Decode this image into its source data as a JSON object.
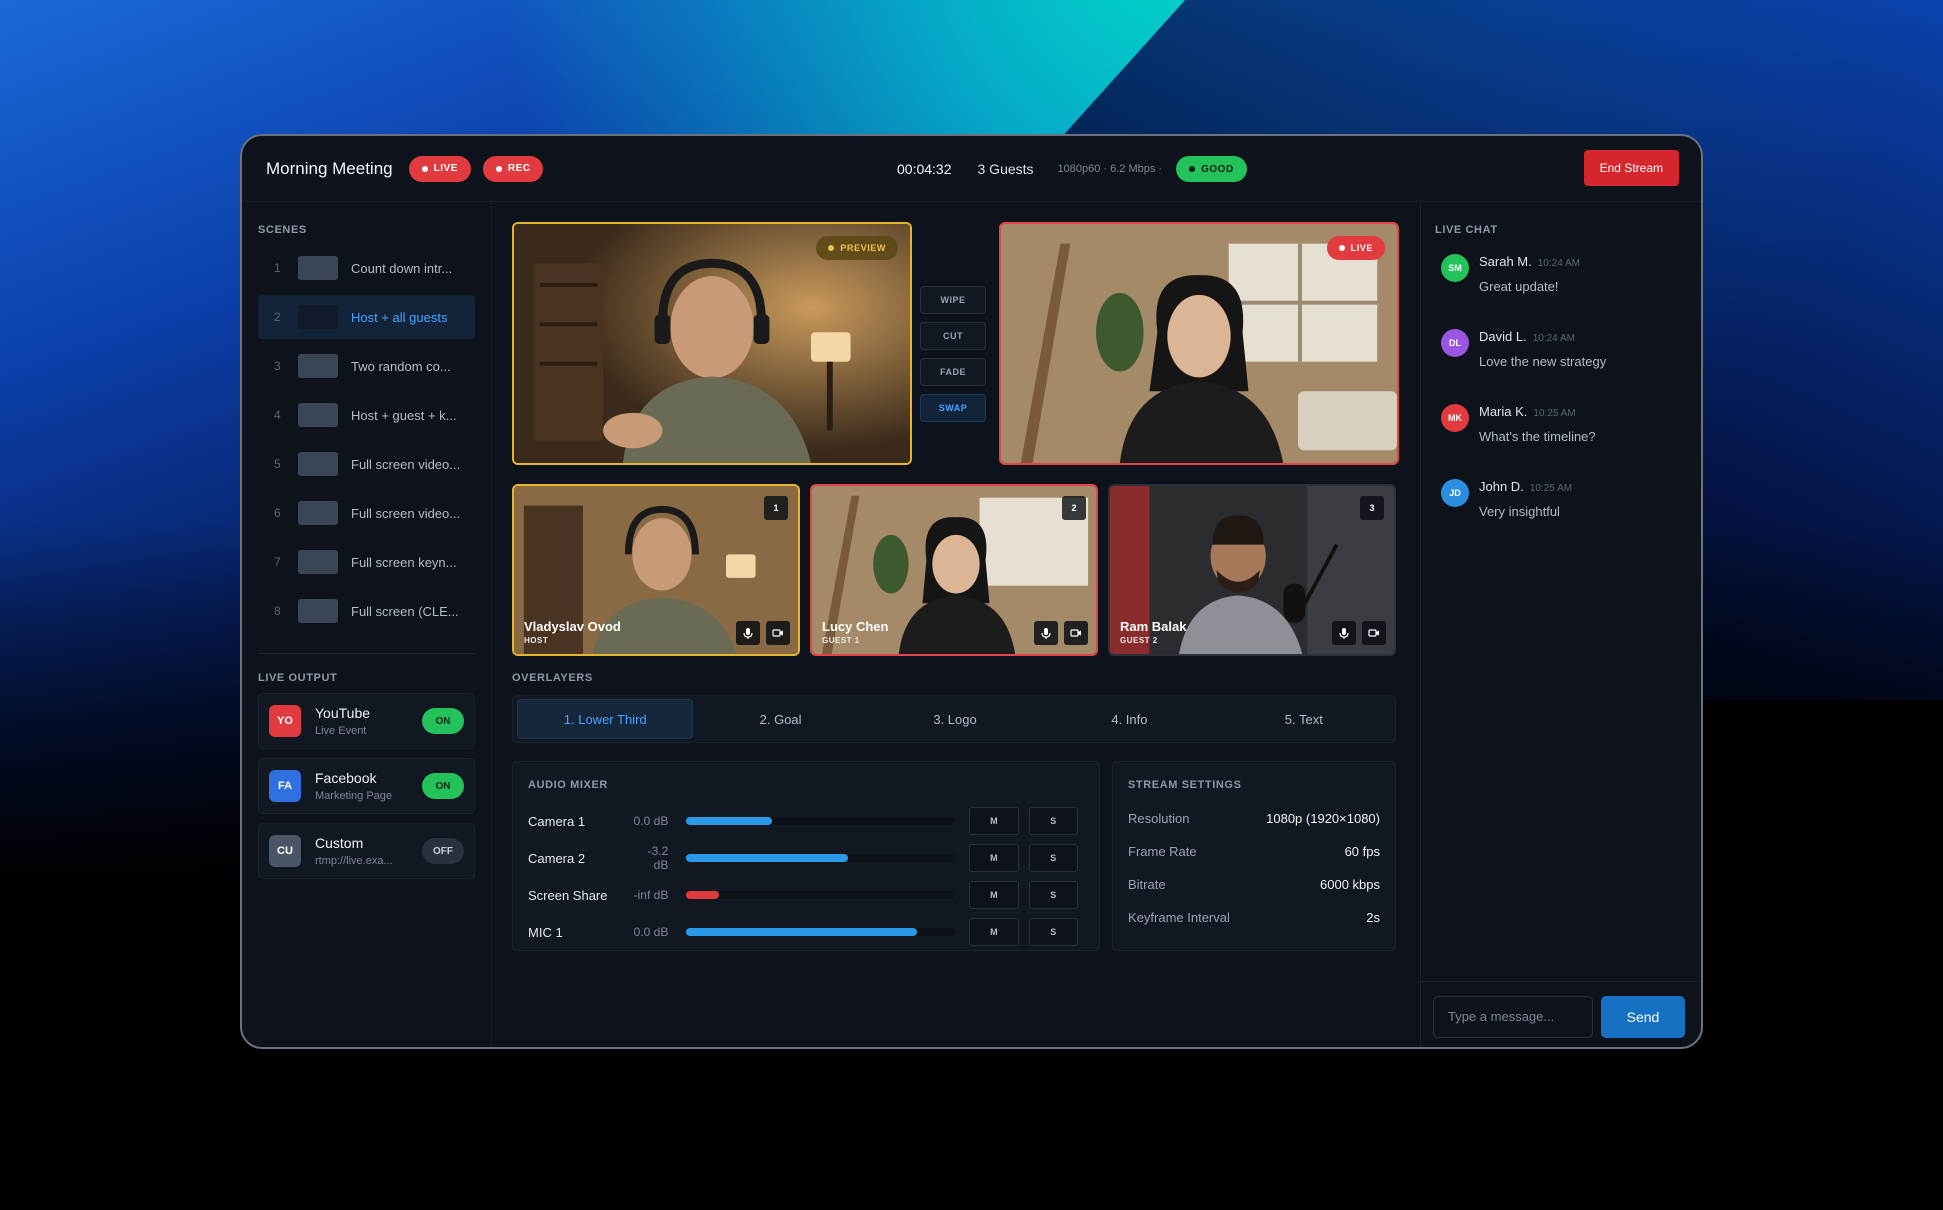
{
  "header": {
    "title": "Morning Meeting",
    "live_label": "LIVE",
    "rec_label": "REC",
    "timer": "00:04:32",
    "guests": "3 Guests",
    "stats": "1080p60 · 6.2 Mbps ·",
    "quality_label": "GOOD",
    "end_button": "End Stream"
  },
  "sidebar": {
    "scenes_title": "SCENES",
    "scenes": [
      {
        "num": "1",
        "name": "Count down intr..."
      },
      {
        "num": "2",
        "name": "Host + all guests",
        "active": true
      },
      {
        "num": "3",
        "name": "Two random co..."
      },
      {
        "num": "4",
        "name": "Host + guest + k..."
      },
      {
        "num": "5",
        "name": "Full screen video..."
      },
      {
        "num": "6",
        "name": "Full screen video..."
      },
      {
        "num": "7",
        "name": "Full screen keyn..."
      },
      {
        "num": "8",
        "name": "Full screen (CLE..."
      }
    ],
    "output_title": "LIVE OUTPUT",
    "outputs": [
      {
        "badge": "YO",
        "name": "YouTube",
        "sub": "Live Event",
        "toggle": "ON",
        "color": "#e23b3f"
      },
      {
        "badge": "FA",
        "name": "Facebook",
        "sub": "Marketing Page",
        "toggle": "ON",
        "color": "#2f6fe0"
      },
      {
        "badge": "CU",
        "name": "Custom",
        "sub": "rtmp://live.exa...",
        "toggle": "OFF",
        "color": "#4a5566"
      }
    ]
  },
  "stage": {
    "preview_label": "PREVIEW",
    "live_label": "LIVE",
    "transitions": [
      "WIPE",
      "CUT",
      "FADE",
      "SWAP"
    ],
    "active_transition": "SWAP"
  },
  "sources": [
    {
      "num": "1",
      "name": "Vladyslav Ovod",
      "role": "HOST"
    },
    {
      "num": "2",
      "name": "Lucy Chen",
      "role": "GUEST 1"
    },
    {
      "num": "3",
      "name": "Ram Balak",
      "role": "GUEST 2"
    }
  ],
  "overlayers": {
    "title": "OVERLAYERS",
    "tabs": [
      "1. Lower Third",
      "2. Goal",
      "3. Logo",
      "4. Info",
      "5. Text"
    ],
    "active": "1. Lower Third"
  },
  "audio_mixer": {
    "title": "AUDIO MIXER",
    "mute_label": "M",
    "solo_label": "S",
    "channels": [
      {
        "name": "Camera 1",
        "db": "0.0 dB",
        "level": 0.32,
        "color": "#2a9ae8"
      },
      {
        "name": "Camera 2",
        "db": "-3.2 dB",
        "level": 0.6,
        "color": "#2a9ae8"
      },
      {
        "name": "Screen Share",
        "db": "-inf dB",
        "level": 0.12,
        "color": "#e23b3f"
      },
      {
        "name": "MIC 1",
        "db": "0.0 dB",
        "level": 0.86,
        "color": "#2a9ae8"
      }
    ]
  },
  "stream_settings": {
    "title": "STREAM SETTINGS",
    "rows": [
      {
        "key": "Resolution",
        "value": "1080p (1920×1080)"
      },
      {
        "key": "Frame Rate",
        "value": "60 fps"
      },
      {
        "key": "Bitrate",
        "value": "6000 kbps"
      },
      {
        "key": "Keyframe Interval",
        "value": "2s"
      }
    ]
  },
  "chat": {
    "title": "LIVE CHAT",
    "messages": [
      {
        "initials": "SM",
        "author": "Sarah M.",
        "time": "10:24 AM",
        "text": "Great update!",
        "color": "#23c25b"
      },
      {
        "initials": "DL",
        "author": "David L.",
        "time": "10:24 AM",
        "text": "Love the new strategy",
        "color": "#9b55e0"
      },
      {
        "initials": "MK",
        "author": "Maria K.",
        "time": "10:25 AM",
        "text": "What's the timeline?",
        "color": "#e23b3f"
      },
      {
        "initials": "JD",
        "author": "John D.",
        "time": "10:25 AM",
        "text": "Very insightful",
        "color": "#2a8fe0"
      }
    ],
    "input_placeholder": "Type a message...",
    "send_label": "Send"
  }
}
